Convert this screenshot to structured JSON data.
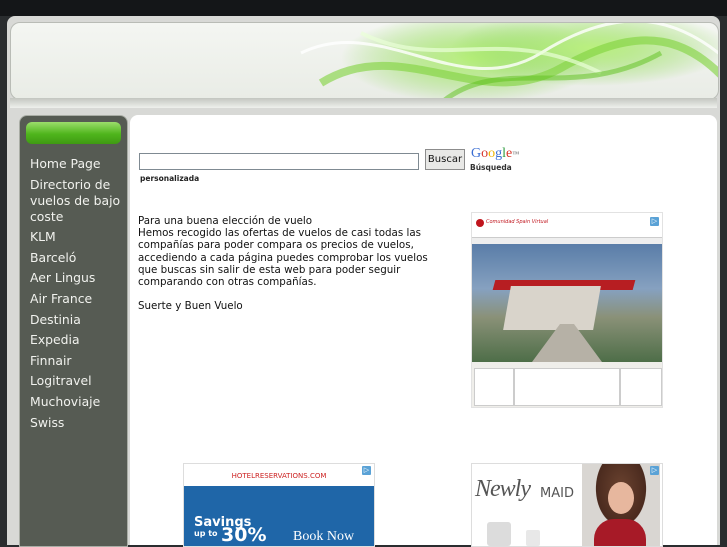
{
  "nav": {
    "items": [
      {
        "label": "Home Page"
      },
      {
        "label": "Directorio de vuelos de bajo coste"
      },
      {
        "label": "KLM"
      },
      {
        "label": "Barceló"
      },
      {
        "label": "Aer Lingus"
      },
      {
        "label": "Air France"
      },
      {
        "label": "Destinia"
      },
      {
        "label": "Expedia"
      },
      {
        "label": "Finnair"
      },
      {
        "label": "Logitravel"
      },
      {
        "label": "Muchoviaje"
      },
      {
        "label": "Swiss"
      }
    ]
  },
  "search": {
    "button_label": "Buscar",
    "logo_text": "Google",
    "logo_tm": "™",
    "busqueda_label": "Búsqueda",
    "personalizada_label": "personalizada",
    "value": ""
  },
  "intro": {
    "text": "Para una buena elección de vuelo\nHemos recogido las ofertas de vuelos de casi todas las compañías para poder compara os precios de vuelos, accediendo a cada página puedes comprobar los vuelos que buscas sin salir de esta web para poder seguir comparando con otras compañías.\n\nSuerte y Buen Vuelo"
  },
  "ads": {
    "ad_mark": "▷",
    "ad1": {
      "brand": "Comunidad Spain Virtual"
    },
    "ad2": {
      "logo": "HOTELRESERVATIONS.COM",
      "savings": "Savings",
      "upto": "up to",
      "pct": "30%",
      "cta": "Book Now"
    },
    "ad3": {
      "brand_script": "Newly",
      "brand_caps": "MAID"
    }
  },
  "colors": {
    "sidebar_bg": "#565b53",
    "accent_green": "#4fb51c",
    "page_bg": "#d8d9d6"
  }
}
